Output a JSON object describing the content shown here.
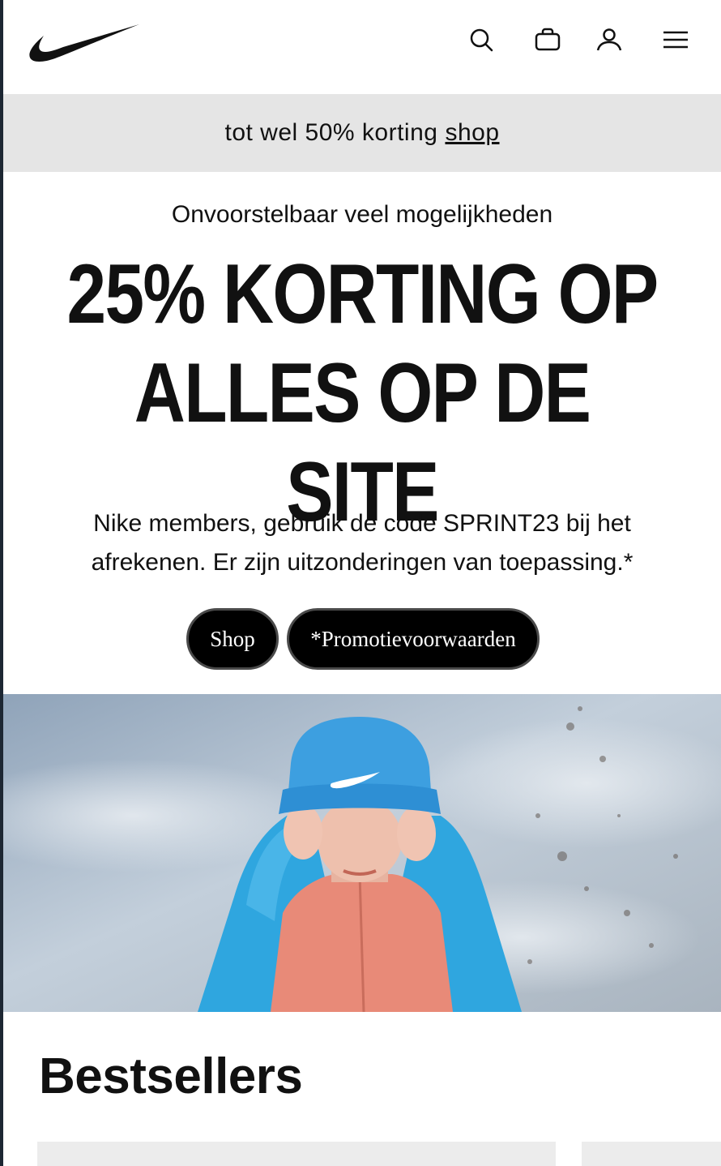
{
  "header": {
    "logo_icon": "nike-swoosh-icon",
    "icons": [
      "search-icon",
      "bag-icon",
      "user-icon",
      "menu-icon"
    ]
  },
  "promo_bar": {
    "text": "tot wel 50% korting",
    "link": "shop",
    "background": "#e5e5e5"
  },
  "hero_text": {
    "kicker": "Onvoorstelbaar veel mogelijkheden",
    "headline_line1": "25% KORTING OP",
    "headline_line2": "ALLES OP DE SITE",
    "body": "Nike members, gebruik de code SPRINT23 bij het afrekenen. Er zijn uitzonderingen van toepassing.*",
    "buttons": {
      "shop": "Shop",
      "terms": "*Promotievoorwaarden"
    }
  },
  "bestsellers": {
    "title": "Bestsellers"
  },
  "colors": {
    "button": "#000000",
    "cap": "#3d9fe0",
    "jacket": "#2fa6df",
    "vest": "#e88a78",
    "sky": "#b9c6d4"
  }
}
